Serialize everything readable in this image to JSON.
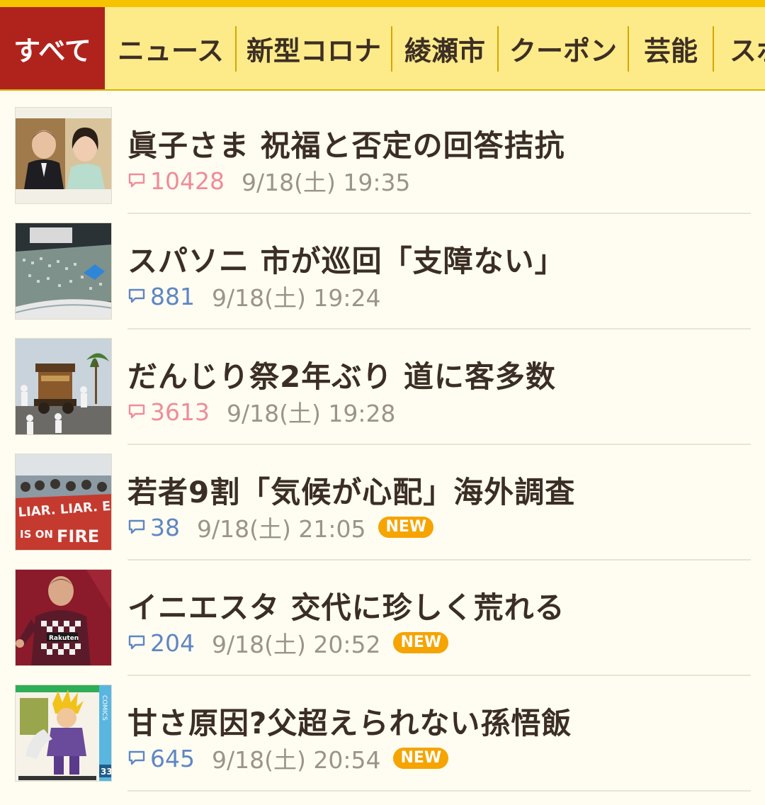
{
  "tabs": [
    {
      "label": "すべて",
      "active": true
    },
    {
      "label": "ニュース",
      "active": false
    },
    {
      "label": "新型コロナ",
      "active": false
    },
    {
      "label": "綾瀬市",
      "active": false
    },
    {
      "label": "クーポン",
      "active": false
    },
    {
      "label": "芸能",
      "active": false
    },
    {
      "label": "スポ",
      "active": false
    }
  ],
  "articles": [
    {
      "title": "眞子さま 祝福と否定の回答拮抗",
      "comments": "10428",
      "hot": true,
      "date": "9/18(土) 19:35",
      "new": false,
      "thumb": "couple-photo"
    },
    {
      "title": "スパソニ 市が巡回「支障ない」",
      "comments": "881",
      "hot": false,
      "date": "9/18(土) 19:24",
      "new": false,
      "thumb": "festival-crowd-photo"
    },
    {
      "title": "だんじり祭2年ぶり 道に客多数",
      "comments": "3613",
      "hot": true,
      "date": "9/18(土) 19:28",
      "new": false,
      "thumb": "danjiri-float-photo"
    },
    {
      "title": "若者9割「気候が心配」海外調査",
      "comments": "38",
      "hot": false,
      "date": "9/18(土) 21:05",
      "new": true,
      "thumb": "climate-protest-photo"
    },
    {
      "title": "イニエスタ 交代に珍しく荒れる",
      "comments": "204",
      "hot": false,
      "date": "9/18(土) 20:52",
      "new": true,
      "thumb": "soccer-player-photo"
    },
    {
      "title": "甘さ原因?父超えられない孫悟飯",
      "comments": "645",
      "hot": false,
      "date": "9/18(土) 20:54",
      "new": true,
      "thumb": "manga-cover-photo"
    }
  ],
  "new_label": "NEW",
  "colors": {
    "active_tab": "#b0231d",
    "tabbar": "#fdeb8a",
    "hot_count": "#ef8c99",
    "normal_count": "#5f86c4",
    "new_badge": "#f5a400"
  }
}
